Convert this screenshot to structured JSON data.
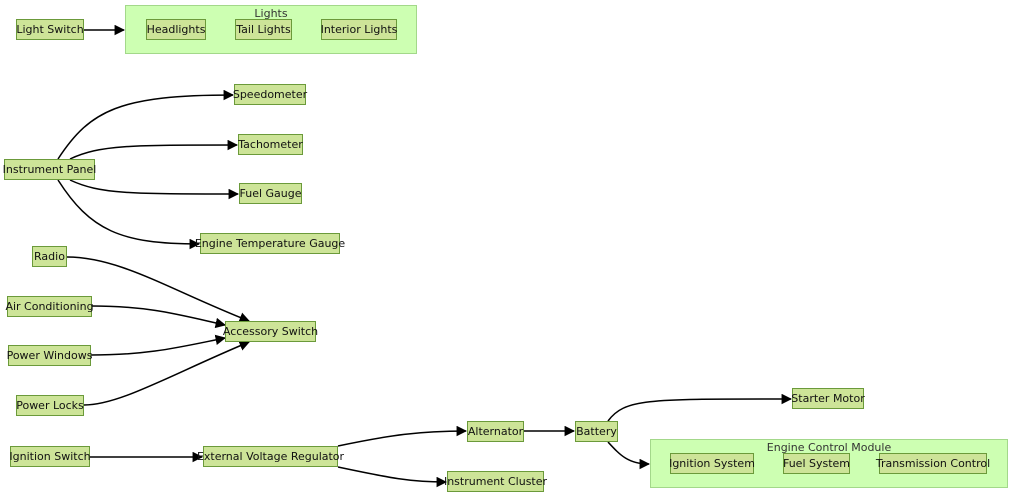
{
  "clusters": {
    "lights": {
      "title": "Lights"
    },
    "ecm": {
      "title": "Engine Control Module"
    }
  },
  "nodes": {
    "light_switch": "Light Switch",
    "headlights": "Headlights",
    "tail_lights": "Tail Lights",
    "interior_lights": "Interior Lights",
    "speedometer": "Speedometer",
    "tachometer": "Tachometer",
    "instrument_panel": "Instrument Panel",
    "fuel_gauge": "Fuel Gauge",
    "engine_temp_gauge": "Engine Temperature Gauge",
    "radio": "Radio",
    "air_conditioning": "Air Conditioning",
    "accessory_switch": "Accessory Switch",
    "power_windows": "Power Windows",
    "power_locks": "Power Locks",
    "starter_motor": "Starter Motor",
    "ignition_switch": "Ignition Switch",
    "external_voltage_regulator": "External Voltage Regulator",
    "alternator": "Alternator",
    "battery": "Battery",
    "ignition_system": "Ignition System",
    "fuel_system": "Fuel System",
    "transmission_control": "Transmission Control",
    "instrument_cluster": "Instrument Cluster"
  },
  "edges": [
    [
      "light_switch",
      "lights"
    ],
    [
      "instrument_panel",
      "speedometer"
    ],
    [
      "instrument_panel",
      "tachometer"
    ],
    [
      "instrument_panel",
      "fuel_gauge"
    ],
    [
      "instrument_panel",
      "engine_temp_gauge"
    ],
    [
      "radio",
      "accessory_switch"
    ],
    [
      "air_conditioning",
      "accessory_switch"
    ],
    [
      "power_windows",
      "accessory_switch"
    ],
    [
      "power_locks",
      "accessory_switch"
    ],
    [
      "ignition_switch",
      "external_voltage_regulator"
    ],
    [
      "external_voltage_regulator",
      "alternator"
    ],
    [
      "external_voltage_regulator",
      "instrument_cluster"
    ],
    [
      "alternator",
      "battery"
    ],
    [
      "battery",
      "starter_motor"
    ],
    [
      "battery",
      "ecm"
    ]
  ],
  "colors": {
    "node_fill": "#cde498",
    "node_stroke": "#6b9a3a",
    "cluster_fill": "#cdffb2",
    "cluster_stroke": "#a3d88a",
    "edge": "#000000"
  }
}
